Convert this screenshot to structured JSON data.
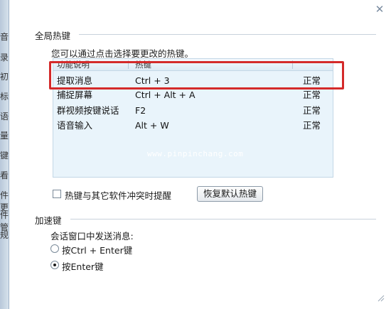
{
  "left_strip": [
    "音",
    "录",
    "初",
    "标",
    "语",
    "量",
    "键",
    "看",
    "件更",
    "件管",
    "规"
  ],
  "dialog": {
    "close_glyph": "✕",
    "hotkeys_section": {
      "title": "全局热键",
      "hint": "您可以通过点击选择要更改的热键。",
      "columns": [
        "功能说明",
        "热键",
        ""
      ],
      "rows": [
        {
          "name": "提取消息",
          "key": "Ctrl + 3",
          "status": "正常"
        },
        {
          "name": "捕捉屏幕",
          "key": "Ctrl + Alt + A",
          "status": "正常"
        },
        {
          "name": "群视频按键说话",
          "key": "F2",
          "status": "正常"
        },
        {
          "name": "语音输入",
          "key": "Alt + W",
          "status": "正常"
        }
      ],
      "watermark": "www.pinpinchang.com",
      "conflict_checkbox_label": "热键与其它软件冲突时提醒",
      "conflict_checked": false,
      "restore_button": "恢复默认热键"
    },
    "accelerator_section": {
      "title": "加速键",
      "send_label": "会话窗口中发送消息:",
      "options": [
        "按Ctrl + Enter键",
        "按Enter键"
      ],
      "selected": "按Enter键"
    }
  },
  "colors": {
    "highlight": "#d42a2a",
    "table_bg": "#e9f4fb"
  }
}
